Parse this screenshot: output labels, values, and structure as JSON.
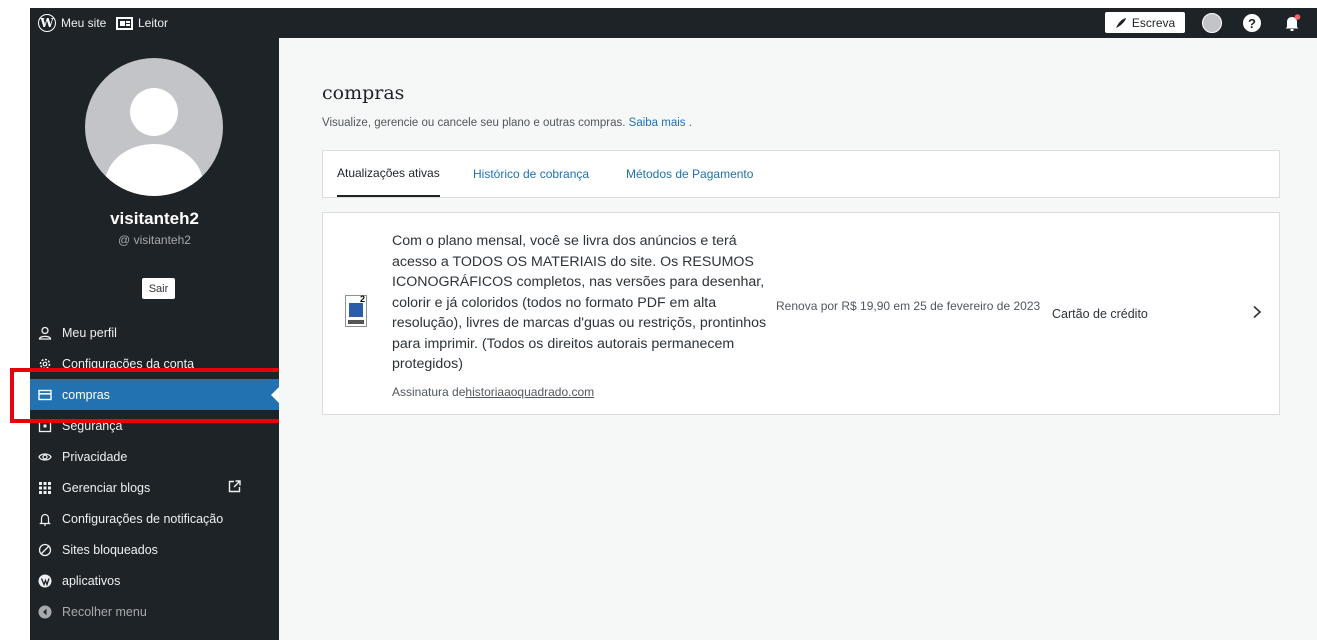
{
  "masterbar": {
    "my_site": "Meu site",
    "reader": "Leitor",
    "write": "Escreva"
  },
  "profile": {
    "display_name": "visitanteh2",
    "username": "@ visitanteh2",
    "signout": "Sair"
  },
  "nav": {
    "items": [
      {
        "label": "Meu perfil",
        "icon": "user-icon"
      },
      {
        "label": "Configurações da conta",
        "icon": "gear-icon"
      },
      {
        "label": "compras",
        "icon": "credit-card-icon"
      },
      {
        "label": "Segurança",
        "icon": "lock-icon"
      },
      {
        "label": "Privacidade",
        "icon": "eye-icon"
      },
      {
        "label": "Gerenciar blogs",
        "icon": "grid-icon"
      },
      {
        "label": "Configurações de notificação",
        "icon": "bell-icon"
      },
      {
        "label": "Sites bloqueados",
        "icon": "block-icon"
      },
      {
        "label": "aplicativos",
        "icon": "wordpress-app-icon"
      },
      {
        "label": "Recolher menu",
        "icon": "collapse-icon"
      }
    ],
    "active_index": 2
  },
  "page": {
    "title": "compras",
    "description": "Visualize, gerencie ou cancele seu plano e outras compras.",
    "learn_more": "Saiba mais",
    "learn_more_suffix": " ."
  },
  "tabs": [
    {
      "label": "Atualizações ativas",
      "active": true
    },
    {
      "label": "Histórico de cobrança",
      "active": false
    },
    {
      "label": "Métodos de Pagamento",
      "active": false
    }
  ],
  "purchase": {
    "description": "Com o plano mensal, você se livra dos anúncios e terá acesso a TODOS OS MATERIAIS do site. Os RESUMOS ICONOGRÁFICOS completos, nas versões para desenhar, colorir e já coloridos (todos no formato PDF em alta resolução), livres de marcas d'guas ou restriçõs, prontinhos para imprimir. (Todos os direitos autorais permanecem protegidos)",
    "site_prefix": "Assinatura de",
    "site": "historiaaoquadrado.com",
    "renewal": "Renova por R$ 19,90 em 25 de fevereiro de 2023",
    "payment_method": "Cartão de crédito"
  },
  "colors": {
    "sidebar_bg": "#1d2327",
    "accent": "#2271b1",
    "highlight": "#e8000a",
    "main_bg": "#f6f7f7"
  }
}
